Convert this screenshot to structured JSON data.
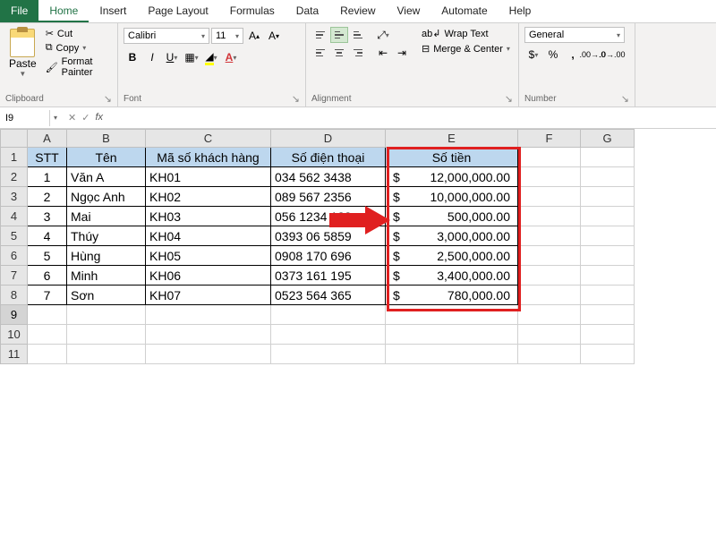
{
  "tabs": {
    "file": "File",
    "home": "Home",
    "insert": "Insert",
    "page_layout": "Page Layout",
    "formulas": "Formulas",
    "data": "Data",
    "review": "Review",
    "view": "View",
    "automate": "Automate",
    "help": "Help"
  },
  "clipboard": {
    "paste": "Paste",
    "cut": "Cut",
    "copy": "Copy",
    "format_painter": "Format Painter",
    "label": "Clipboard"
  },
  "font": {
    "name": "Calibri",
    "size": "11",
    "label": "Font"
  },
  "alignment": {
    "wrap": "Wrap Text",
    "merge": "Merge & Center",
    "label": "Alignment"
  },
  "number": {
    "format": "General",
    "label": "Number"
  },
  "namebox": "I9",
  "fx": "fx",
  "cols": [
    "A",
    "B",
    "C",
    "D",
    "E",
    "F",
    "G"
  ],
  "rows": [
    "1",
    "2",
    "3",
    "4",
    "5",
    "6",
    "7",
    "8",
    "9",
    "10",
    "11"
  ],
  "headers": {
    "stt": "STT",
    "ten": "Tên",
    "ma": "Mã số khách hàng",
    "sdt": "Số điện thoại",
    "tien": "Số tiền"
  },
  "cur": "$",
  "data": [
    {
      "stt": "1",
      "ten": "Văn A",
      "ma": "KH01",
      "sdt": "034 562 3438",
      "tien": "12,000,000.00"
    },
    {
      "stt": "2",
      "ten": "Ngọc Anh",
      "ma": "KH02",
      "sdt": "089 567 2356",
      "tien": "10,000,000.00"
    },
    {
      "stt": "3",
      "ten": "Mai",
      "ma": "KH03",
      "sdt": "056 1234 123",
      "tien": "500,000.00"
    },
    {
      "stt": "4",
      "ten": "Thúy",
      "ma": "KH04",
      "sdt": "0393 06 5859",
      "tien": "3,000,000.00"
    },
    {
      "stt": "5",
      "ten": "Hùng",
      "ma": "KH05",
      "sdt": "0908 170 696",
      "tien": "2,500,000.00"
    },
    {
      "stt": "6",
      "ten": "Minh",
      "ma": "KH06",
      "sdt": "0373 161 195",
      "tien": "3,400,000.00"
    },
    {
      "stt": "7",
      "ten": "Sơn",
      "ma": "KH07",
      "sdt": "0523 564 365",
      "tien": "780,000.00"
    }
  ]
}
